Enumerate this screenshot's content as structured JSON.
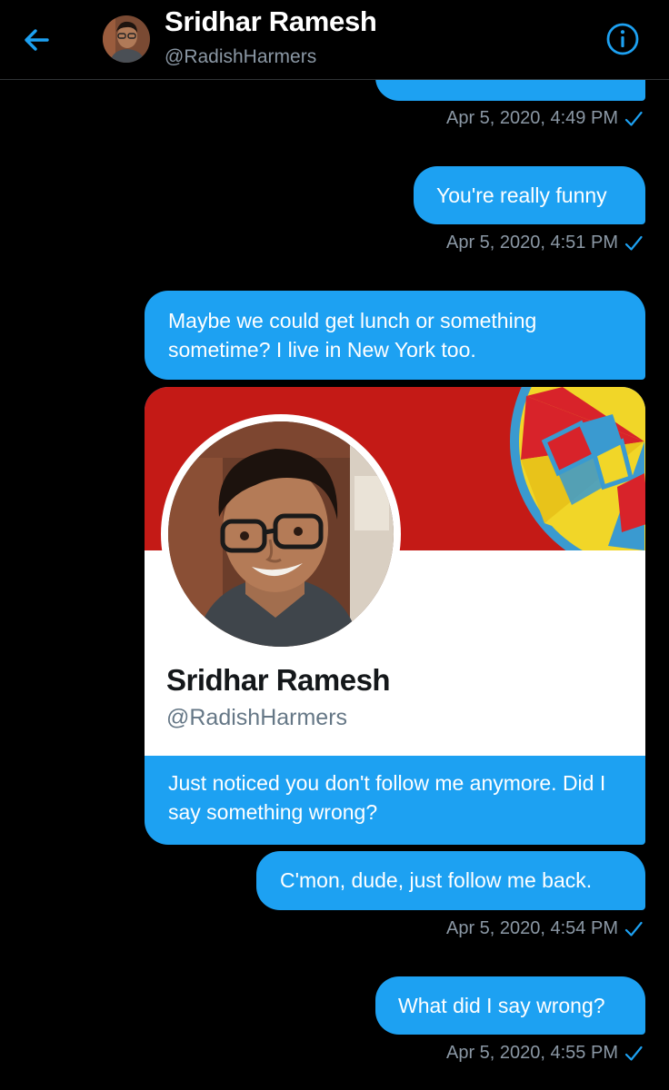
{
  "header": {
    "name": "Sridhar Ramesh",
    "handle": "@RadishHarmers"
  },
  "messages": [
    {
      "text": "",
      "timestamp": "Apr 5, 2020, 4:49 PM"
    },
    {
      "text": "You're really funny",
      "timestamp": "Apr 5, 2020, 4:51 PM"
    },
    {
      "text": "Maybe we could get lunch or something sometime? I live in New York too."
    },
    {
      "text": "C'mon, dude, just follow me back.",
      "timestamp": "Apr 5, 2020, 4:54 PM"
    },
    {
      "text": "What did I say wrong?",
      "timestamp": "Apr 5, 2020, 4:55 PM"
    }
  ],
  "profile_card": {
    "name": "Sridhar Ramesh",
    "handle": "@RadishHarmers",
    "message": "Just noticed you don't follow me anymore. Did I say something wrong?"
  },
  "icons": {
    "back": "arrow-left-icon",
    "info": "info-icon",
    "read": "checkmark-icon"
  },
  "colors": {
    "accent": "#1da1f2",
    "background": "#000000",
    "secondary_text": "#8b98a5",
    "banner_red": "#c41a16"
  }
}
